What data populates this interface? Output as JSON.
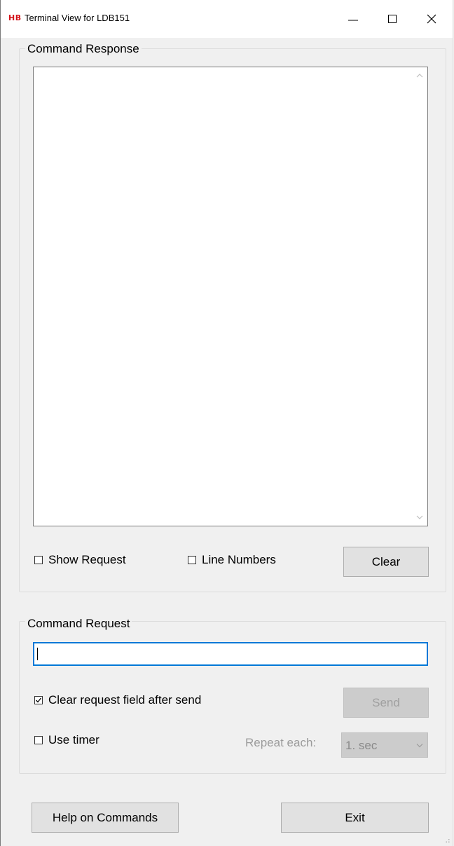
{
  "window": {
    "logo_text": "HB",
    "title": "Terminal View for LDB151",
    "accent_logo_color": "#d4141b",
    "focus_color": "#0078d7"
  },
  "response_group": {
    "label": "Command Response",
    "output_text": "",
    "show_request": {
      "label": "Show Request",
      "checked": false
    },
    "line_numbers": {
      "label": "Line Numbers",
      "checked": false
    },
    "clear_label": "Clear"
  },
  "request_group": {
    "label": "Command Request",
    "input_value": "",
    "clear_after_send": {
      "label": "Clear request field after send",
      "checked": true
    },
    "send_label": "Send",
    "use_timer": {
      "label": "Use timer",
      "checked": false
    },
    "repeat_label": "Repeat each:",
    "repeat_value": "1. sec"
  },
  "footer": {
    "help_label": "Help on Commands",
    "exit_label": "Exit"
  },
  "icons": [
    "minimize-icon",
    "maximize-icon",
    "close-icon",
    "scroll-up-icon",
    "scroll-down-icon",
    "checkmark-icon",
    "chevron-down-icon",
    "resize-grip-icon"
  ]
}
